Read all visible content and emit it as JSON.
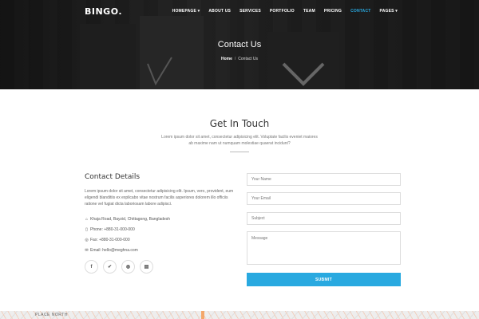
{
  "brand": "BINGO.",
  "nav": {
    "items": [
      "HOMEPAGE",
      "ABOUT US",
      "SERVICES",
      "PORTFOLIO",
      "TEAM",
      "PRICING",
      "CONTACT",
      "PAGES"
    ],
    "active": "CONTACT"
  },
  "hero": {
    "title": "Contact Us",
    "breadcrumb_home": "Home",
    "breadcrumb_current": "Contact Us"
  },
  "intro": {
    "title": "Get In Touch",
    "subtitle": "Lorem ipsum dolor sit amet, consectetur adipisicing elit. Voluptate facilis eveniet maiores ab maxime nam ut numquam molestiae quaerat incidunt?"
  },
  "contact": {
    "title": "Contact Details",
    "text": "Lorem ipsum dolor sit amet, consectetur adipisicing elit. Ipsum, vero, provident, eum eligendi blanditiis ex explicabo vitae nostrum facilis asperiores dolorem illo officiis ratione vel fugiat dicta laboriosam labore adipisci.",
    "address": "Khaja Road, Bayzid, Chittagong, Bangladesh",
    "phone": "Phone: +880-31-000-000",
    "fax": "Fax: +880-31-000-000",
    "email": "Email: hello@meghna.com"
  },
  "form": {
    "name_placeholder": "Your Name",
    "email_placeholder": "Your Email",
    "subject_placeholder": "Subject",
    "message_placeholder": "Message",
    "submit_label": "SUBMIT"
  },
  "map": {
    "label": "PLACE NORTH"
  },
  "colors": {
    "accent": "#29a9e0"
  }
}
